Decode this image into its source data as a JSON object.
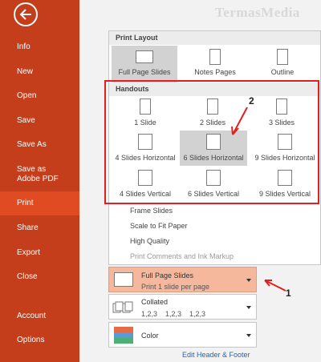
{
  "sidebar": {
    "items": [
      {
        "label": "Info"
      },
      {
        "label": "New"
      },
      {
        "label": "Open"
      },
      {
        "label": "Save"
      },
      {
        "label": "Save As"
      },
      {
        "label": "Save as Adobe PDF"
      },
      {
        "label": "Print",
        "active": true
      },
      {
        "label": "Share"
      },
      {
        "label": "Export"
      },
      {
        "label": "Close"
      },
      {
        "label": "Account"
      },
      {
        "label": "Options"
      }
    ]
  },
  "watermark": "TermasMedia",
  "dropdown": {
    "print_layout_header": "Print Layout",
    "print_layout": [
      "Full Page Slides",
      "Notes Pages",
      "Outline"
    ],
    "handouts_header": "Handouts",
    "handouts": [
      "1 Slide",
      "2 Slides",
      "3 Slides",
      "4 Slides Horizontal",
      "6 Slides Horizontal",
      "9 Slides Horizontal",
      "4 Slides Vertical",
      "6 Slides Vertical",
      "9 Slides Vertical"
    ],
    "options": [
      "Frame Slides",
      "Scale to Fit Paper",
      "High Quality",
      "Print Comments and Ink Markup"
    ]
  },
  "settings": {
    "layout_main": "Full Page Slides",
    "layout_sub": "Print 1 slide per page",
    "collated_main": "Collated",
    "collated_sub": "1,2,3    1,2,3    1,2,3",
    "color_main": "Color"
  },
  "footer_link": "Edit Header & Footer",
  "annotations": {
    "one": "1",
    "two": "2"
  },
  "colors": {
    "sidebar": "#c43e1c",
    "active": "#e14b21",
    "highlight": "#f6b89d",
    "annotation": "#e02020"
  }
}
